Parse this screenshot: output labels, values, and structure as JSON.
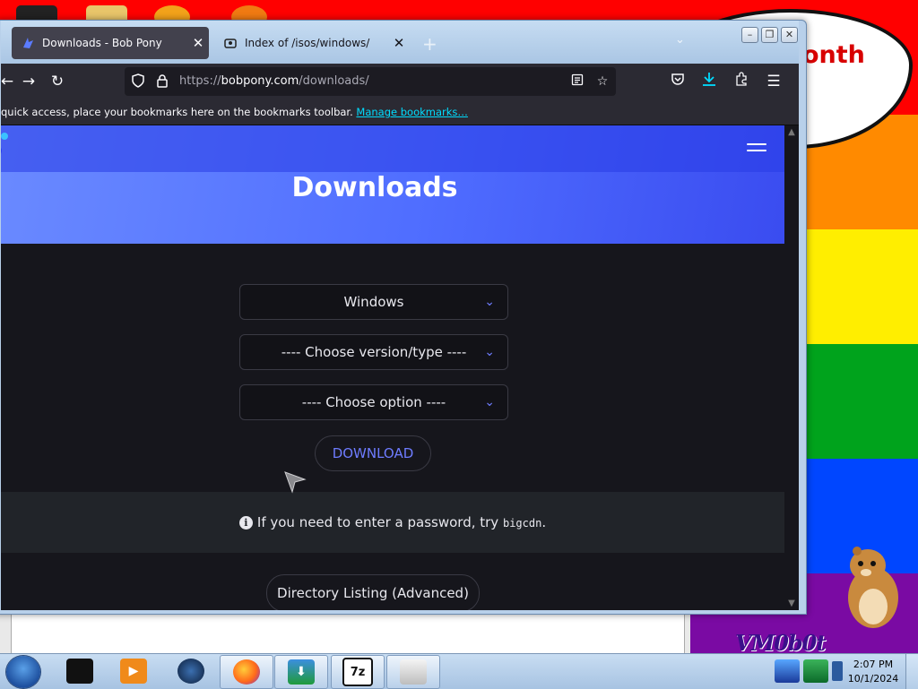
{
  "browser": {
    "tabs": [
      {
        "label": "Downloads - Bob Pony",
        "active": true,
        "icon": "bobpony-favicon"
      },
      {
        "label": "Index of /isos/windows/",
        "active": false,
        "icon": "page-icon"
      }
    ],
    "tab_close": "✕",
    "new_tab": "+",
    "list_tabs": "⌄",
    "window_controls": {
      "minimize": "–",
      "restore": "❐",
      "close": "✕"
    },
    "url": {
      "host": "bobpony.com",
      "scheme": "https://",
      "path": "/downloads/"
    },
    "bookmarks_bar": {
      "message": "quick access, place your bookmarks here on the bookmarks toolbar.",
      "link": "Manage bookmarks…"
    }
  },
  "page": {
    "title": "Downloads",
    "selects": [
      {
        "value": "Windows"
      },
      {
        "value": "---- Choose version/type ----"
      },
      {
        "value": "---- Choose option ----"
      }
    ],
    "download_button": "DOWNLOAD",
    "notice": {
      "prefix": "If you need to enter a password, try ",
      "code": "bigcdn",
      "suffix": "."
    },
    "directory_button": "Directory Listing (Advanced)"
  },
  "desktop": {
    "speech_text": "onth",
    "logo_text": "VM0b0t"
  },
  "taskbar": {
    "items": [
      {
        "name": "terminal",
        "open": false,
        "glyph": ""
      },
      {
        "name": "media-player",
        "open": false,
        "glyph": "▶"
      },
      {
        "name": "globe",
        "open": false,
        "glyph": ""
      },
      {
        "name": "firefox",
        "open": true,
        "glyph": ""
      },
      {
        "name": "internet-download-manager",
        "open": true,
        "glyph": "⬇"
      },
      {
        "name": "7-zip",
        "open": true,
        "glyph": "7z"
      },
      {
        "name": "recycle-bin",
        "open": true,
        "glyph": ""
      }
    ],
    "clock": {
      "time": "2:07 PM",
      "date": "10/1/2024"
    }
  },
  "colors": {
    "accent": "#6e7cff",
    "hero_start": "#6a8aff",
    "hero_end": "#3a4cf0",
    "page_bg": "#16161c",
    "link": "#00ddff"
  }
}
